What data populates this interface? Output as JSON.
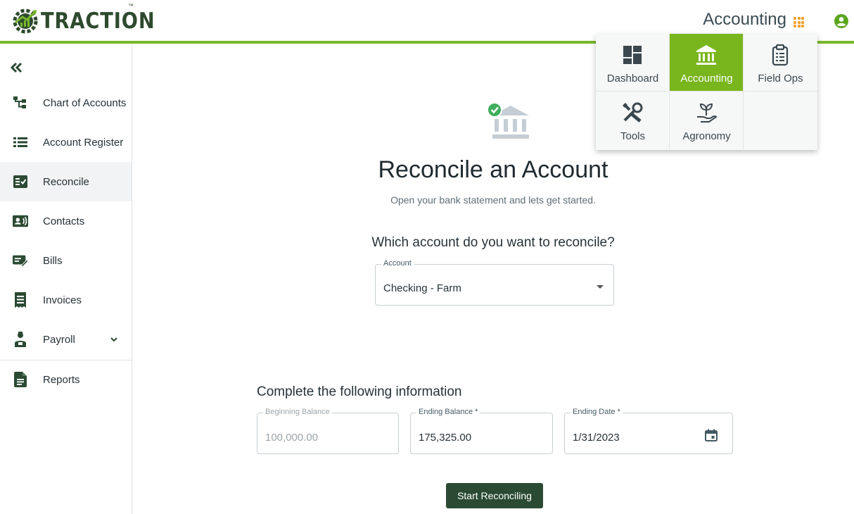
{
  "brand": {
    "name": "TRACTION",
    "trademark": "™"
  },
  "header": {
    "module_title": "Accounting",
    "apps_icon": "apps-grid-icon",
    "user_icon": "account-circle-icon",
    "accent_color": "#76b82a"
  },
  "sidebar": {
    "collapse_icon": "double-chevron-left-icon",
    "items": [
      {
        "label": "Chart of Accounts",
        "icon": "hierarchy-icon"
      },
      {
        "label": "Account Register",
        "icon": "list-icon"
      },
      {
        "label": "Reconcile",
        "icon": "checklist-icon",
        "active": true
      },
      {
        "label": "Contacts",
        "icon": "contact-card-icon"
      },
      {
        "label": "Bills",
        "icon": "bill-edit-icon"
      },
      {
        "label": "Invoices",
        "icon": "receipt-icon"
      },
      {
        "label": "Payroll",
        "icon": "worker-icon",
        "expandable": true
      },
      {
        "label": "Reports",
        "icon": "document-icon"
      }
    ]
  },
  "main": {
    "title": "Reconcile an Account",
    "subtitle": "Open your bank statement and lets get started.",
    "question": "Which account do you want to reconcile?",
    "account_field": {
      "label": "Account",
      "value": "Checking - Farm"
    },
    "section_title": "Complete the following information",
    "beginning_balance": {
      "label": "Beginning Balance",
      "value": "100,000.00",
      "disabled": true
    },
    "ending_balance": {
      "label": "Ending Balance *",
      "value": "175,325.00"
    },
    "ending_date": {
      "label": "Ending Date *",
      "value": "1/31/2023"
    },
    "start_button": "Start Reconciling",
    "button_color": "#2b4a33"
  },
  "app_menu": {
    "active_color": "#79b51c",
    "items": [
      {
        "label": "Dashboard",
        "icon": "dashboard-icon"
      },
      {
        "label": "Accounting",
        "icon": "bank-icon",
        "active": true
      },
      {
        "label": "Field Ops",
        "icon": "clipboard-icon"
      },
      {
        "label": "Tools",
        "icon": "tools-icon"
      },
      {
        "label": "Agronomy",
        "icon": "plant-hand-icon"
      }
    ]
  }
}
